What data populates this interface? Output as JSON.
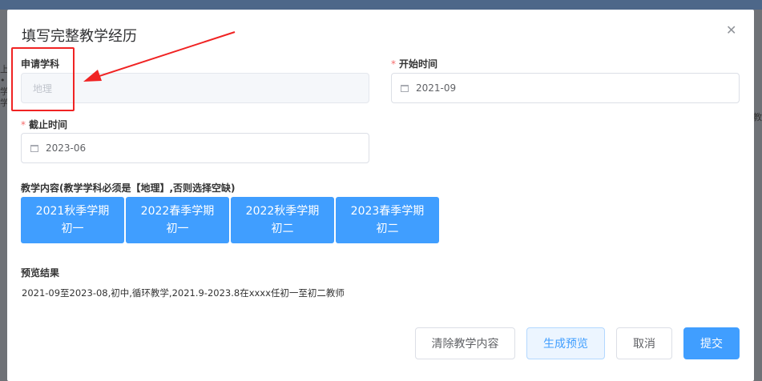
{
  "background_edges": {
    "left": "上 • 学 学",
    "right": "教"
  },
  "dialog": {
    "title": "填写完整教学经历",
    "close_icon": "close-icon"
  },
  "form": {
    "subject": {
      "label": "申请学科",
      "value": "地理"
    },
    "start_time": {
      "required_mark": "*",
      "label": "开始时间",
      "value": "2021-09"
    },
    "end_time": {
      "required_mark": "*",
      "label": "截止时间",
      "value": "2023-06"
    },
    "teaching_content": {
      "label": "教学内容(教学学科必须是【地理】,否则选择空缺)",
      "items": [
        {
          "term": "2021秋季学期",
          "grade": "初一"
        },
        {
          "term": "2022春季学期",
          "grade": "初一"
        },
        {
          "term": "2022秋季学期",
          "grade": "初二"
        },
        {
          "term": "2023春季学期",
          "grade": "初二"
        }
      ]
    },
    "preview": {
      "label": "预览结果",
      "text": "2021-09至2023-08,初中,循环教学,2021.9-2023.8在xxxx任初一至初二教师"
    }
  },
  "footer": {
    "clear_label": "清除教学内容",
    "preview_label": "生成预览",
    "cancel_label": "取消",
    "submit_label": "提交"
  },
  "colors": {
    "primary": "#409eff",
    "required": "#f56c6c",
    "annotation_red": "#f02323"
  }
}
